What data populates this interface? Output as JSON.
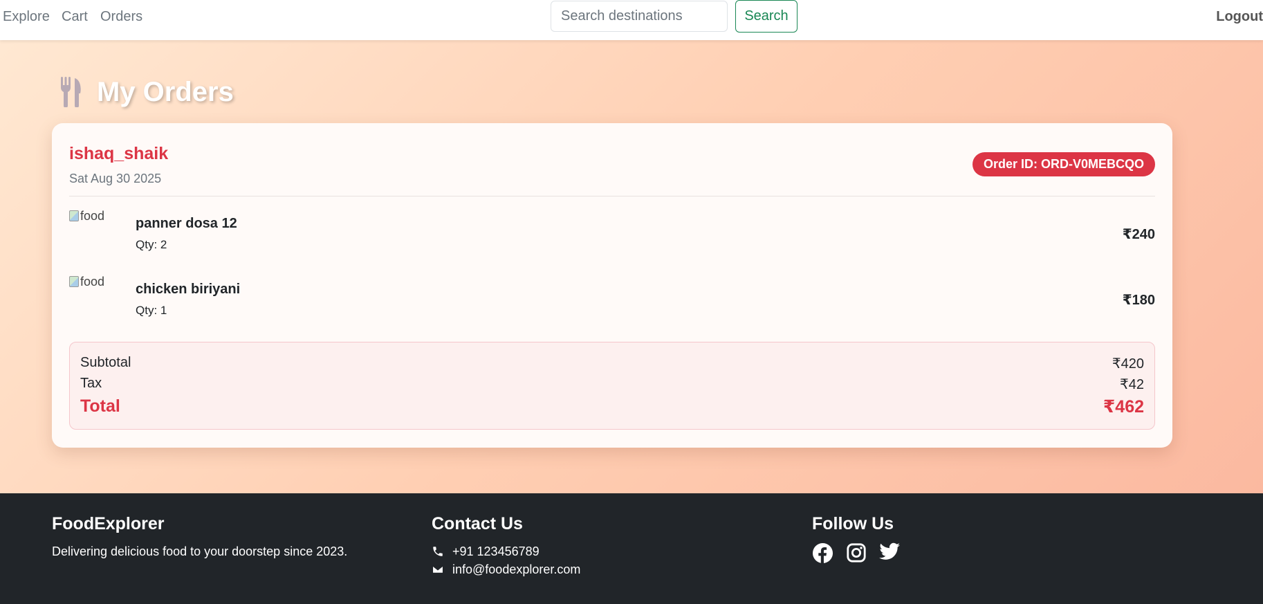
{
  "nav": {
    "links": [
      "Explore",
      "Cart",
      "Orders"
    ],
    "search_placeholder": "Search destinations",
    "search_label": "Search",
    "logout_label": "Logout"
  },
  "page": {
    "title": "My Orders",
    "title_icon": "fork-knife-icon"
  },
  "order": {
    "username": "ishaq_shaik",
    "date": "Sat Aug 30 2025",
    "order_id": "Order ID: ORD-V0MEBCQO",
    "items": [
      {
        "image_alt": "food",
        "name": "panner dosa 12",
        "qty": "Qty: 2",
        "price": "₹240"
      },
      {
        "image_alt": "food",
        "name": "chicken biriyani",
        "qty": "Qty: 1",
        "price": "₹180"
      }
    ],
    "summary": {
      "subtotal_label": "Subtotal",
      "subtotal": "₹420",
      "tax_label": "Tax",
      "tax": "₹42",
      "total_label": "Total",
      "total": "₹462"
    }
  },
  "footer": {
    "brand": "FoodExplorer",
    "tagline": "Delivering delicious food to your doorstep since 2023.",
    "contact_title": "Contact Us",
    "phone": "+91 123456789",
    "email": "info@foodexplorer.com",
    "follow_title": "Follow Us",
    "social_icons": [
      "facebook-icon",
      "instagram-icon",
      "twitter-icon"
    ]
  },
  "colors": {
    "accent_red": "#dc3545",
    "search_green": "#198754",
    "footer_bg": "#212529"
  }
}
